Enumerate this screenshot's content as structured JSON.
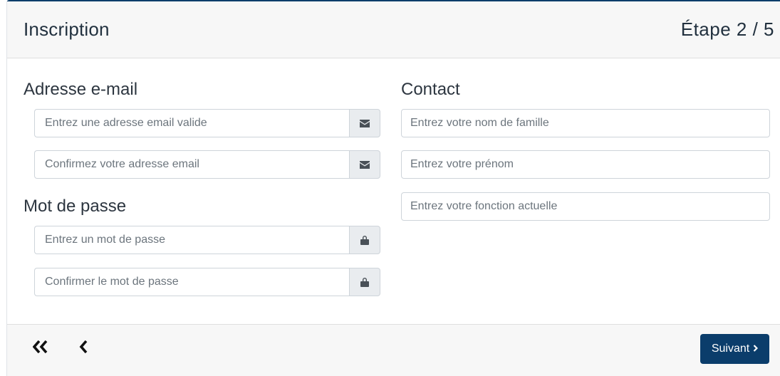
{
  "header": {
    "title": "Inscription",
    "step": "Étape 2 / 5"
  },
  "email_section": {
    "label": "Adresse e-mail",
    "email_placeholder": "Entrez une adresse email valide",
    "email_confirm_placeholder": "Confirmez votre adresse email",
    "icon": "envelope-icon"
  },
  "password_section": {
    "label": "Mot de passe",
    "password_placeholder": "Entrez un mot de passe",
    "password_confirm_placeholder": "Confirmer le mot de passe",
    "icon": "lock-icon"
  },
  "contact_section": {
    "label": "Contact",
    "lastname_placeholder": "Entrez votre nom de famille",
    "firstname_placeholder": "Entrez votre prénom",
    "function_placeholder": "Entrez votre fonction actuelle"
  },
  "footer": {
    "first_icon": "double-chevron-left-icon",
    "prev_icon": "chevron-left-icon",
    "next_label": "Suivant",
    "next_icon": "chevron-right-icon"
  },
  "colors": {
    "primary": "#0b3d6b",
    "header_bg": "#f7f7f7",
    "addon_bg": "#e9ecef"
  }
}
